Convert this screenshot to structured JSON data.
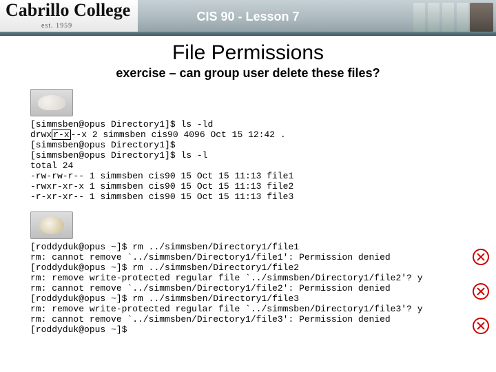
{
  "banner": {
    "logo_text": "Cabrillo College",
    "est": "est. 1959",
    "course": "CIS 90 - Lesson 7"
  },
  "heading": "File Permissions",
  "subtitle": "exercise – can group user delete these files?",
  "terminal1": {
    "l1a": "[simmsben@opus Directory1]$ ",
    "l1b": "ls -ld",
    "l2a": "drwx",
    "l2box": "r-x",
    "l2b": "--x 2 simmsben cis90 4096 Oct 15 12:42 .",
    "l3": "[simmsben@opus Directory1]$",
    "l4a": "[simmsben@opus Directory1]$ ",
    "l4b": "ls -l",
    "l5": "total 24",
    "l6": "-rw-rw-r-- 1 simmsben cis90 15 Oct 15 11:13 file1",
    "l7": "-rwxr-xr-x 1 simmsben cis90 15 Oct 15 11:13 file2",
    "l8": "-r-xr-xr-- 1 simmsben cis90 15 Oct 15 11:13 file3"
  },
  "terminal2": {
    "l1a": "[roddyduk@opus ~]$ ",
    "l1b": "rm ../simmsben/Directory1/file1",
    "l2": "rm: cannot remove `../simmsben/Directory1/file1': Permission denied",
    "l3a": "[roddyduk@opus ~]$ ",
    "l3b": "rm ../simmsben/Directory1/file2",
    "l4": "rm: remove write-protected regular file `../simmsben/Directory1/file2'? y",
    "l5": "rm: cannot remove `../simmsben/Directory1/file2': Permission denied",
    "l6a": "[roddyduk@opus ~]$ ",
    "l6b": "rm ../simmsben/Directory1/file3",
    "l7": "rm: remove write-protected regular file `../simmsben/Directory1/file3'? y",
    "l8": "rm: cannot remove `../simmsben/Directory1/file3': Permission denied",
    "l9": "[roddyduk@opus ~]$"
  }
}
